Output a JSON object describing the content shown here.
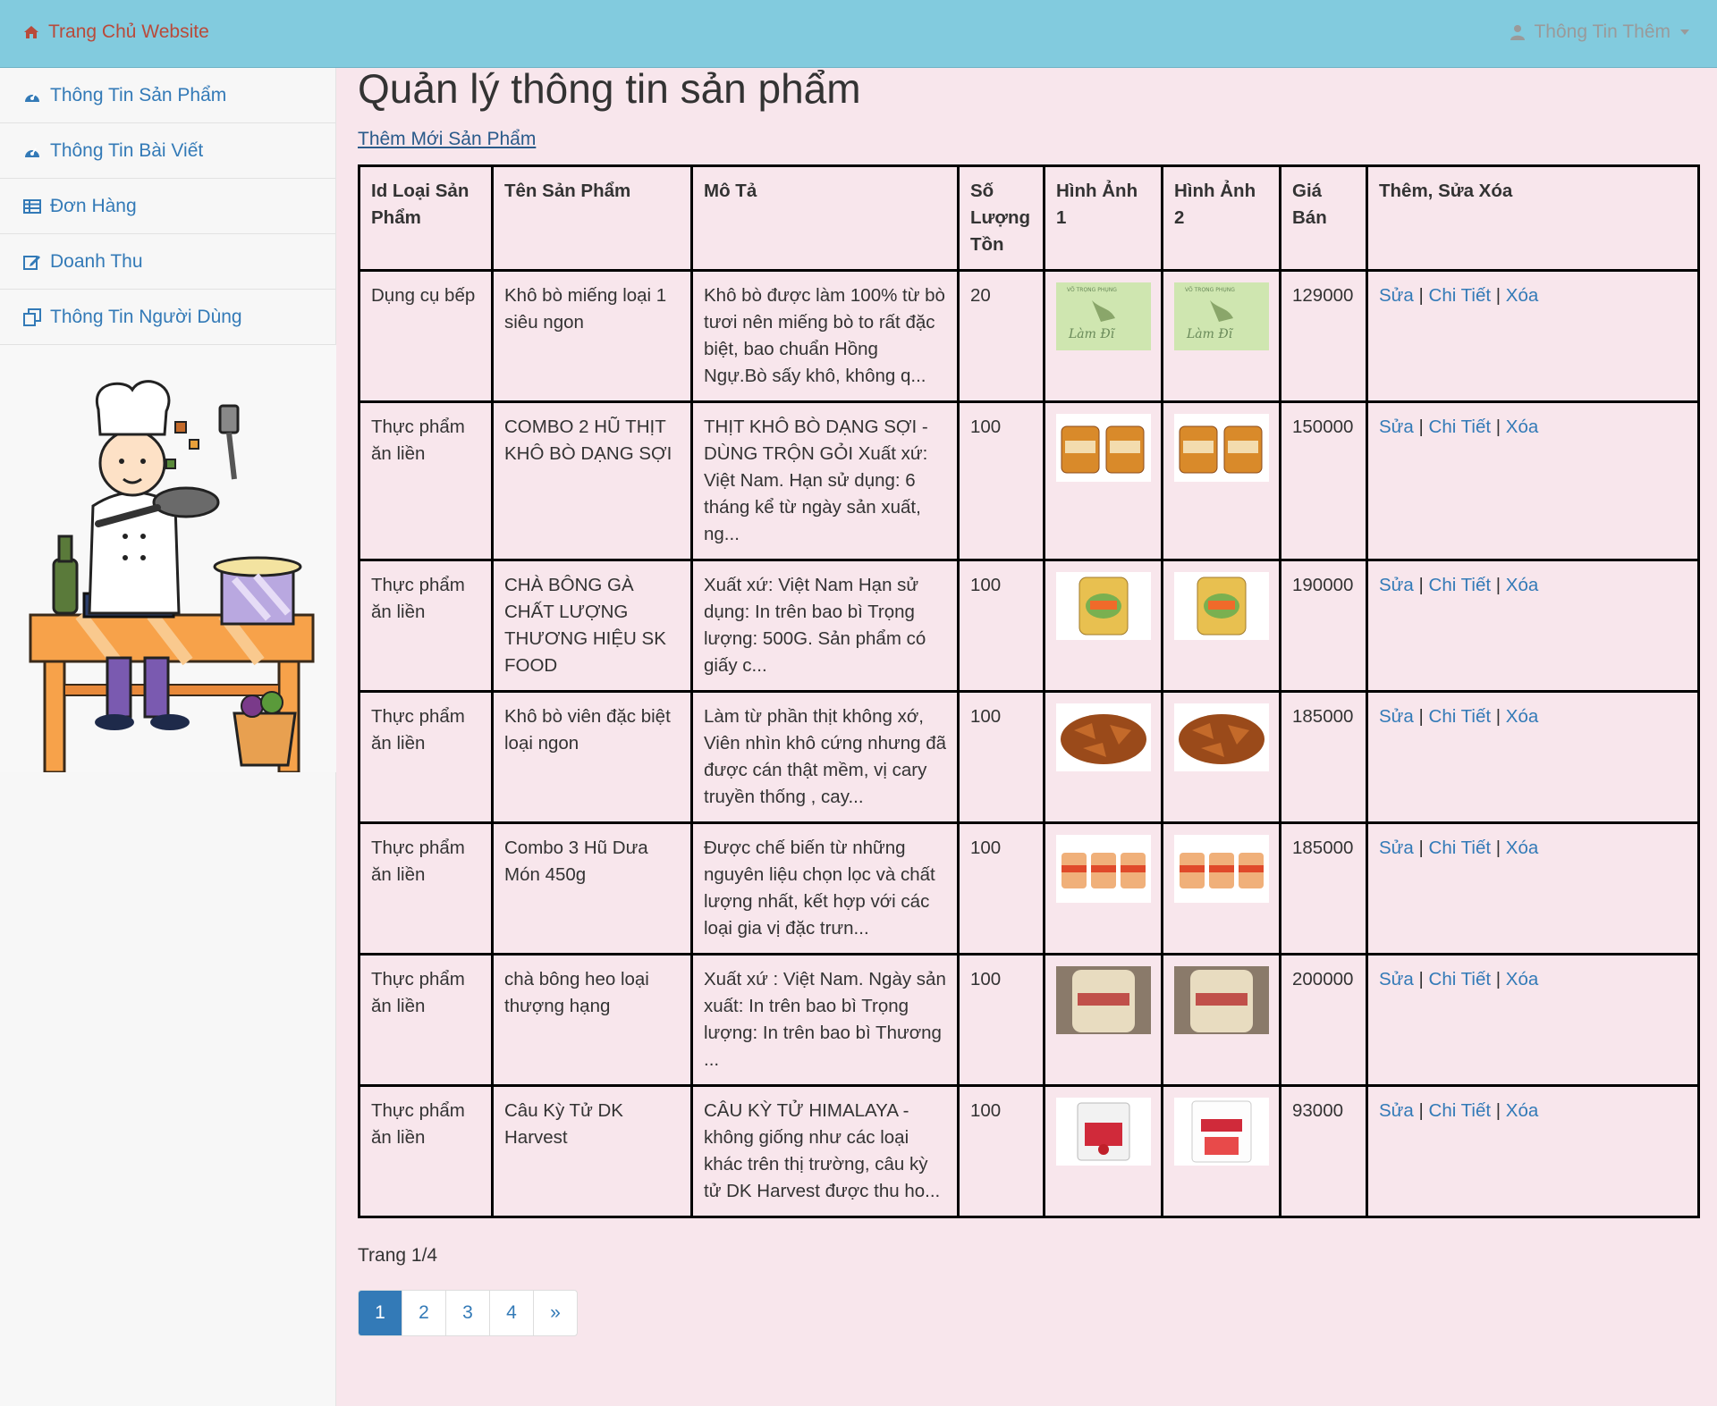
{
  "nav": {
    "brand": "Trang Chủ Website",
    "user_menu": "Thông Tin Thêm"
  },
  "sidebar": {
    "items": [
      {
        "label": "Thông Tin Sản Phẩm",
        "icon": "dashboard-icon"
      },
      {
        "label": "Thông Tin Bài Viết",
        "icon": "dashboard-icon"
      },
      {
        "label": "Đơn Hàng",
        "icon": "table-icon"
      },
      {
        "label": "Doanh Thu",
        "icon": "edit-icon"
      },
      {
        "label": "Thông Tin Người Dùng",
        "icon": "copy-icon"
      }
    ]
  },
  "main": {
    "title": "Quản lý thông tin sản phẩm",
    "add_link": "Thêm Mới Sản Phẩm",
    "columns": [
      "Id Loại Sản Phẩm",
      "Tên Sản Phẩm",
      "Mô Tả",
      "Số Lượng Tồn",
      "Hình Ảnh 1",
      "Hình Ảnh 2",
      "Giá Bán",
      "Thêm, Sửa Xóa"
    ],
    "actions": {
      "edit": "Sửa",
      "detail": "Chi Tiết",
      "delete": "Xóa",
      "separator": "|"
    },
    "rows": [
      {
        "category": "Dụng cụ bếp",
        "name": "Khô bò miếng loại 1 siêu ngon",
        "desc": "Khô bò được làm 100% từ bò tươi nên miếng bò to rất đặc biệt, bao chuẩn Hồng Ngự.Bò sấy khô, không q...",
        "stock": "20",
        "price": "129000",
        "img": "green-logo"
      },
      {
        "category": "Thực phẩm ăn liền",
        "name": "COMBO 2 HŨ THỊT KHÔ BÒ DẠNG SỢI",
        "desc": "THỊT KHÔ BÒ DẠNG SỢI - DÙNG TRỘN GỎI Xuất xứ: Việt Nam. Hạn sử dụng: 6 tháng kể từ ngày sản xuất, ng...",
        "stock": "100",
        "price": "150000",
        "img": "jars"
      },
      {
        "category": "Thực phẩm ăn liền",
        "name": "CHÀ BÔNG GÀ CHẤT LƯỢNG THƯƠNG HIỆU SK FOOD",
        "desc": "Xuất xứ: Việt Nam Hạn sử dụng: In trên bao bì Trọng lượng: 500G. Sản phẩm có giấy c...",
        "stock": "100",
        "price": "190000",
        "img": "yellow-jar"
      },
      {
        "category": "Thực phẩm ăn liền",
        "name": "Khô bò viên đặc biệt loại ngon",
        "desc": "Làm từ phần thịt không xớ, Viên nhìn khô cứng nhưng đã được cán thật mềm, vị cary truyền thống , cay...",
        "stock": "100",
        "price": "185000",
        "img": "jerky"
      },
      {
        "category": "Thực phẩm ăn liền",
        "name": "Combo 3 Hũ Dưa Món 450g",
        "desc": "Được chế biến từ những nguyên liệu chọn lọc và chất lượng nhất, kết hợp với các loại gia vị đặc trưn...",
        "stock": "100",
        "price": "185000",
        "img": "three-jars"
      },
      {
        "category": "Thực phẩm ăn liền",
        "name": "chà bông heo loại thượng hạng",
        "desc": "Xuất xứ : Việt Nam. Ngày sản xuất: In trên bao bì Trọng lượng: In trên bao bì Thương ...",
        "stock": "100",
        "price": "200000",
        "img": "floss"
      },
      {
        "category": "Thực phẩm ăn liền",
        "name": "Câu Kỳ Tử DK Harvest",
        "desc": "CÂU KỲ TỬ HIMALAYA - không giống như các loại khác trên thị trường, câu kỳ tử DK Harvest được thu ho...",
        "stock": "100",
        "price": "93000",
        "img": "bag"
      }
    ],
    "page_info": "Trang 1/4",
    "pages": [
      "1",
      "2",
      "3",
      "4",
      "»"
    ]
  },
  "colors": {
    "topbar": "#82cbde",
    "link": "#337ab7",
    "background": "#f8e6ec"
  }
}
